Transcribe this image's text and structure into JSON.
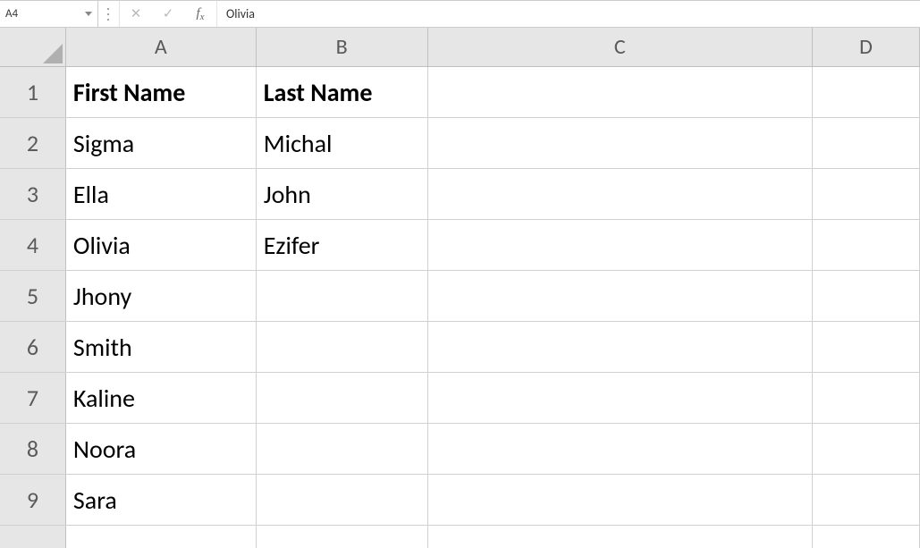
{
  "formula_bar": {
    "name_box": "A4",
    "cancel_icon": "✕",
    "enter_icon": "✓",
    "fx_label_f": "f",
    "fx_label_x": "x",
    "formula_value": "Olivia"
  },
  "columns": {
    "A": "A",
    "B": "B",
    "C": "C",
    "D": "D"
  },
  "rows": [
    {
      "num": "1",
      "A": "First Name",
      "B": "Last Name",
      "C": "",
      "D": "",
      "header": true
    },
    {
      "num": "2",
      "A": "Sigma",
      "B": "Michal",
      "C": "",
      "D": ""
    },
    {
      "num": "3",
      "A": "Ella",
      "B": "John",
      "C": "",
      "D": ""
    },
    {
      "num": "4",
      "A": "Olivia",
      "B": "Ezifer",
      "C": "",
      "D": ""
    },
    {
      "num": "5",
      "A": "Jhony",
      "B": "",
      "C": "",
      "D": ""
    },
    {
      "num": "6",
      "A": "Smith",
      "B": "",
      "C": "",
      "D": ""
    },
    {
      "num": "7",
      "A": "Kaline",
      "B": "",
      "C": "",
      "D": ""
    },
    {
      "num": "8",
      "A": "Noora",
      "B": "",
      "C": "",
      "D": ""
    },
    {
      "num": "9",
      "A": "Sara",
      "B": "",
      "C": "",
      "D": ""
    }
  ]
}
